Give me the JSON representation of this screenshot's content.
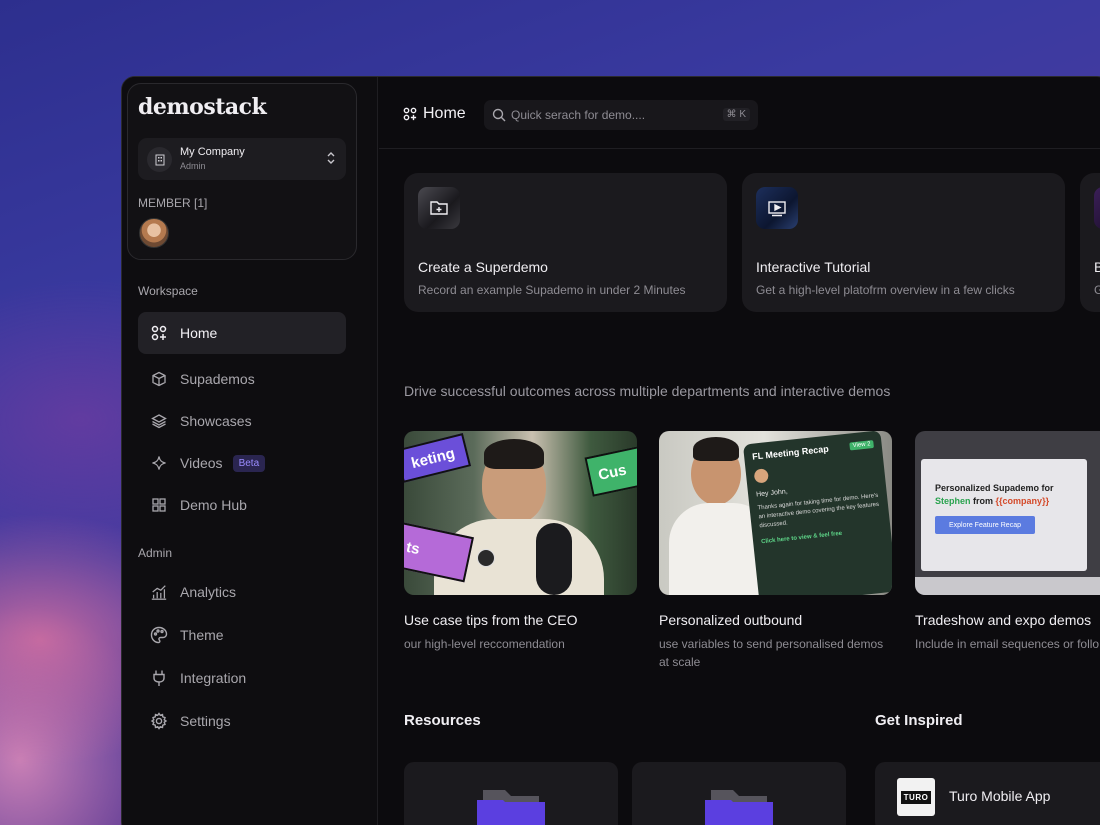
{
  "app": {
    "logo": "demostack"
  },
  "company": {
    "name": "My Company",
    "role": "Admin"
  },
  "members": {
    "label": "MEMBER [1]"
  },
  "sidebar": {
    "workspace_label": "Workspace",
    "workspace_items": [
      {
        "label": "Home",
        "icon": "home-grid-icon",
        "active": true
      },
      {
        "label": "Supademos",
        "icon": "cube-icon"
      },
      {
        "label": "Showcases",
        "icon": "layers-icon"
      },
      {
        "label": "Videos",
        "icon": "sparkle-icon",
        "badge": "Beta"
      },
      {
        "label": "Demo Hub",
        "icon": "grid-icon"
      }
    ],
    "admin_label": "Admin",
    "admin_items": [
      {
        "label": "Analytics",
        "icon": "chart-icon"
      },
      {
        "label": "Theme",
        "icon": "palette-icon"
      },
      {
        "label": "Integration",
        "icon": "plug-icon"
      },
      {
        "label": "Settings",
        "icon": "gear-icon"
      }
    ]
  },
  "header": {
    "title": "Home",
    "search_placeholder": "Quick serach for demo....",
    "shortcut": "⌘ K"
  },
  "quick_actions": [
    {
      "title": "Create a Superdemo",
      "subtitle": "Record an example Supademo in under 2 Minutes",
      "icon": "folder-plus-icon"
    },
    {
      "title": "Interactive Tutorial",
      "subtitle": "Get a high-level platofrm overview in a few clicks",
      "icon": "video-play-icon"
    },
    {
      "title": "B",
      "subtitle": "G",
      "icon": ""
    }
  ],
  "headline": "Drive successful outcomes across multiple departments and interactive demos",
  "demos": [
    {
      "title": "Use case tips from the CEO",
      "subtitle": "our high-level reccomendation",
      "tags": [
        "keting",
        "Cus",
        "ts"
      ]
    },
    {
      "title": "Personalized outbound",
      "subtitle": "use variables to send personalised demos at scale",
      "mock": {
        "heading": "FL Meeting Recap",
        "tag": "View 2",
        "greeting": "Hey John,",
        "body": "Thanks again for taking time for demo. Here's an interactive demo covering the key features discussed.",
        "link": "Click here to view & feel free"
      }
    },
    {
      "title": "Tradeshow and expo demos",
      "subtitle": "Include in email sequences or follo",
      "mock": {
        "line1": "Personalized Supademo for",
        "name": "Stephen",
        "from": "from",
        "var": "{{company}}",
        "button": "Explore Feature Recap"
      }
    }
  ],
  "resources": {
    "title": "Resources"
  },
  "inspired": {
    "title": "Get Inspired",
    "item": "Turo Mobile App",
    "logo_text": "TURO"
  }
}
